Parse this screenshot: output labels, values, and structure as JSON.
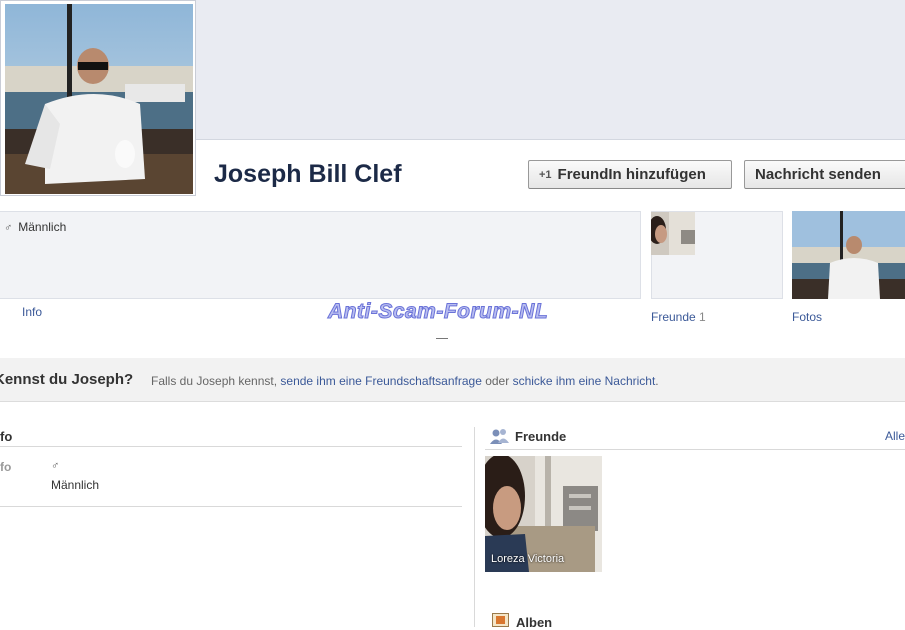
{
  "profile": {
    "name": "Joseph Bill Clef",
    "gender_symbol": "♂",
    "gender": "Männlich"
  },
  "actions": {
    "add_friend_icon": "+1",
    "add_friend_label": "FreundIn hinzufügen",
    "message_label": "Nachricht senden"
  },
  "tabs": {
    "info": "Info",
    "friends": "Freunde",
    "friends_count": "1",
    "photos": "Fotos"
  },
  "watermark": "Anti-Scam-Forum-NL",
  "know_bar": {
    "title": "Kennst du Joseph?",
    "text_before": "Falls du Joseph kennst, ",
    "link_request": "sende ihm eine Freundschaftsanfrage",
    "text_middle": " oder ",
    "link_message": "schicke ihm eine Nachricht",
    "text_after": "."
  },
  "info_section": {
    "title": "fo",
    "row_label": "fo",
    "gender_symbol": "♂",
    "gender": "Männlich"
  },
  "friends_section": {
    "title": "Freunde",
    "all_link": "Alle",
    "friend_name": "Loreza Victoria"
  },
  "albums_section": {
    "title": "Alben"
  },
  "icons": [
    "male-icon",
    "add-friend-icon",
    "friends-icon",
    "albums-icon"
  ],
  "colors": {
    "link": "#3b5998",
    "name": "#1c2a47",
    "cover": "#e9ebf2"
  }
}
